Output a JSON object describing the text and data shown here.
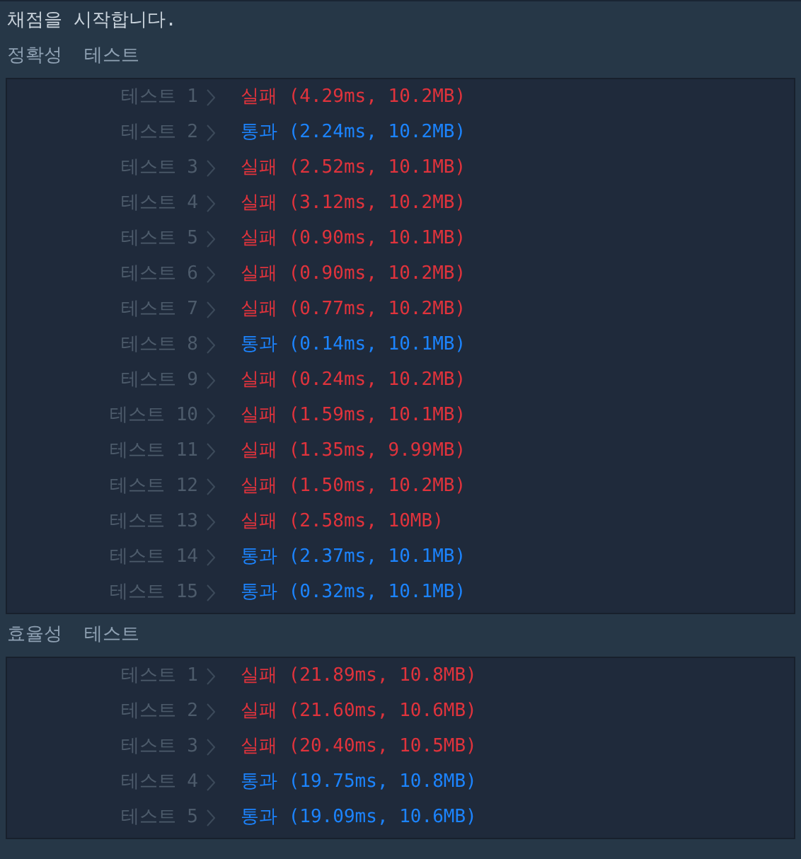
{
  "message": "채점을 시작합니다.",
  "sections": [
    {
      "title": "정확성  테스트",
      "tests": [
        {
          "label": "테스트 1",
          "passed": false,
          "status": "실패",
          "detail": "(4.29ms, 10.2MB)"
        },
        {
          "label": "테스트 2",
          "passed": true,
          "status": "통과",
          "detail": "(2.24ms, 10.2MB)"
        },
        {
          "label": "테스트 3",
          "passed": false,
          "status": "실패",
          "detail": "(2.52ms, 10.1MB)"
        },
        {
          "label": "테스트 4",
          "passed": false,
          "status": "실패",
          "detail": "(3.12ms, 10.2MB)"
        },
        {
          "label": "테스트 5",
          "passed": false,
          "status": "실패",
          "detail": "(0.90ms, 10.1MB)"
        },
        {
          "label": "테스트 6",
          "passed": false,
          "status": "실패",
          "detail": "(0.90ms, 10.2MB)"
        },
        {
          "label": "테스트 7",
          "passed": false,
          "status": "실패",
          "detail": "(0.77ms, 10.2MB)"
        },
        {
          "label": "테스트 8",
          "passed": true,
          "status": "통과",
          "detail": "(0.14ms, 10.1MB)"
        },
        {
          "label": "테스트 9",
          "passed": false,
          "status": "실패",
          "detail": "(0.24ms, 10.2MB)"
        },
        {
          "label": "테스트 10",
          "passed": false,
          "status": "실패",
          "detail": "(1.59ms, 10.1MB)"
        },
        {
          "label": "테스트 11",
          "passed": false,
          "status": "실패",
          "detail": "(1.35ms, 9.99MB)"
        },
        {
          "label": "테스트 12",
          "passed": false,
          "status": "실패",
          "detail": "(1.50ms, 10.2MB)"
        },
        {
          "label": "테스트 13",
          "passed": false,
          "status": "실패",
          "detail": "(2.58ms, 10MB)"
        },
        {
          "label": "테스트 14",
          "passed": true,
          "status": "통과",
          "detail": "(2.37ms, 10.1MB)"
        },
        {
          "label": "테스트 15",
          "passed": true,
          "status": "통과",
          "detail": "(0.32ms, 10.1MB)"
        }
      ]
    },
    {
      "title": "효율성  테스트",
      "tests": [
        {
          "label": "테스트 1",
          "passed": false,
          "status": "실패",
          "detail": "(21.89ms, 10.8MB)"
        },
        {
          "label": "테스트 2",
          "passed": false,
          "status": "실패",
          "detail": "(21.60ms, 10.6MB)"
        },
        {
          "label": "테스트 3",
          "passed": false,
          "status": "실패",
          "detail": "(20.40ms, 10.5MB)"
        },
        {
          "label": "테스트 4",
          "passed": true,
          "status": "통과",
          "detail": "(19.75ms, 10.8MB)"
        },
        {
          "label": "테스트 5",
          "passed": true,
          "status": "통과",
          "detail": "(19.09ms, 10.6MB)"
        }
      ]
    }
  ]
}
